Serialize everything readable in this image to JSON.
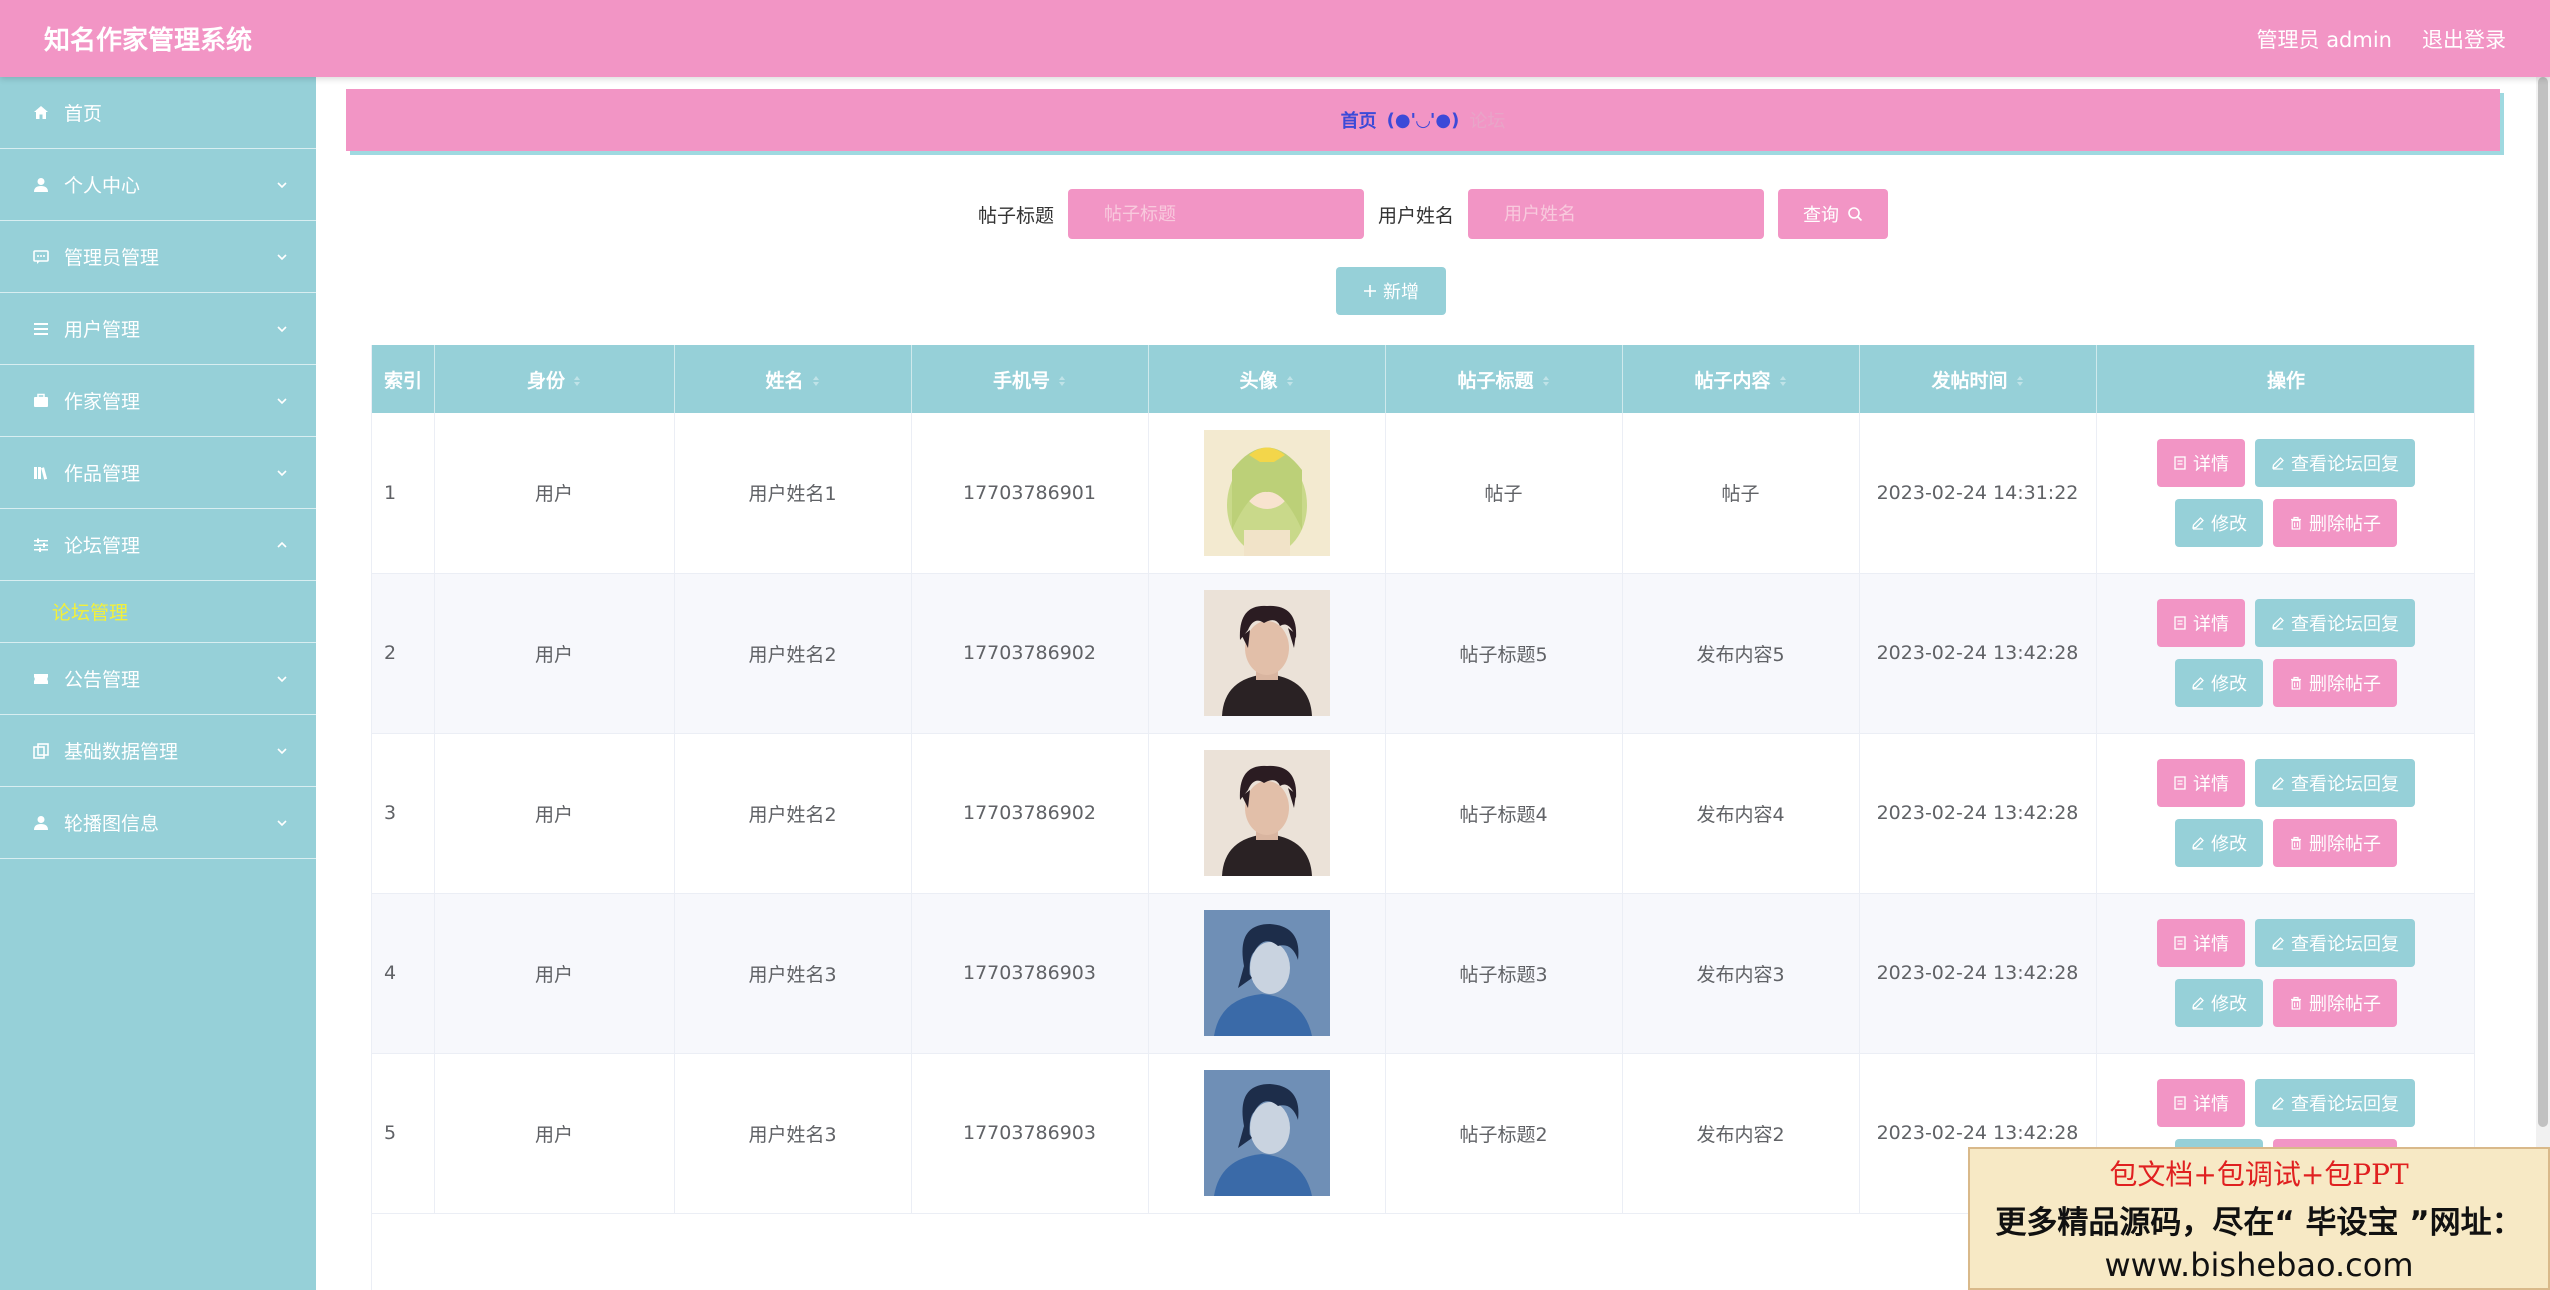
{
  "header": {
    "title": "知名作家管理系统",
    "user_label": "管理员 admin",
    "logout_label": "退出登录"
  },
  "sidebar": {
    "items": [
      {
        "label": "首页",
        "icon": "home-icon"
      },
      {
        "label": "个人中心",
        "icon": "user-icon"
      },
      {
        "label": "管理员管理",
        "icon": "message-icon"
      },
      {
        "label": "用户管理",
        "icon": "menu-icon"
      },
      {
        "label": "作家管理",
        "icon": "briefcase-icon"
      },
      {
        "label": "作品管理",
        "icon": "books-icon"
      },
      {
        "label": "论坛管理",
        "icon": "sliders-icon"
      },
      {
        "label": "公告管理",
        "icon": "ticket-icon"
      },
      {
        "label": "基础数据管理",
        "icon": "copy-icon"
      },
      {
        "label": "轮播图信息",
        "icon": "user-icon"
      }
    ],
    "submenu": {
      "label": "论坛管理"
    }
  },
  "breadcrumb": {
    "home": "首页",
    "face": "(●'◡'●)",
    "current": "论坛"
  },
  "search": {
    "title_label": "帖子标题",
    "title_placeholder": "帖子标题",
    "name_label": "用户姓名",
    "name_placeholder": "用户姓名",
    "query_label": "查询"
  },
  "add_label": "新增",
  "table": {
    "headers": [
      "索引",
      "身份",
      "姓名",
      "手机号",
      "头像",
      "帖子标题",
      "帖子内容",
      "发帖时间",
      "操作"
    ],
    "rows": [
      {
        "index": "1",
        "role": "用户",
        "name": "用户姓名1",
        "phone": "17703786901",
        "avatar": "yellow",
        "title": "帖子",
        "content": "帖子",
        "time": "2023-02-24 14:31:22"
      },
      {
        "index": "2",
        "role": "用户",
        "name": "用户姓名2",
        "phone": "17703786902",
        "avatar": "dark",
        "title": "帖子标题5",
        "content": "发布内容5",
        "time": "2023-02-24 13:42:28"
      },
      {
        "index": "3",
        "role": "用户",
        "name": "用户姓名2",
        "phone": "17703786902",
        "avatar": "dark",
        "title": "帖子标题4",
        "content": "发布内容4",
        "time": "2023-02-24 13:42:28"
      },
      {
        "index": "4",
        "role": "用户",
        "name": "用户姓名3",
        "phone": "17703786903",
        "avatar": "blue",
        "title": "帖子标题3",
        "content": "发布内容3",
        "time": "2023-02-24 13:42:28"
      },
      {
        "index": "5",
        "role": "用户",
        "name": "用户姓名3",
        "phone": "17703786903",
        "avatar": "blue",
        "title": "帖子标题2",
        "content": "发布内容2",
        "time": "2023-02-24 13:42:28"
      }
    ],
    "ops": {
      "detail": "详情",
      "reply": "查看论坛回复",
      "edit": "修改",
      "delete": "删除帖子"
    }
  },
  "ad": {
    "line1": "包文档+包调试+包PPT",
    "line2": "更多精品源码，尽在“ 毕设宝 ”网址：",
    "line3": "www.bishebao.com"
  },
  "colors": {
    "pink": "#f295c5",
    "teal": "#96d0d8",
    "link_blue": "#3c4ad8",
    "submenu_yellow": "#f3f03a"
  }
}
